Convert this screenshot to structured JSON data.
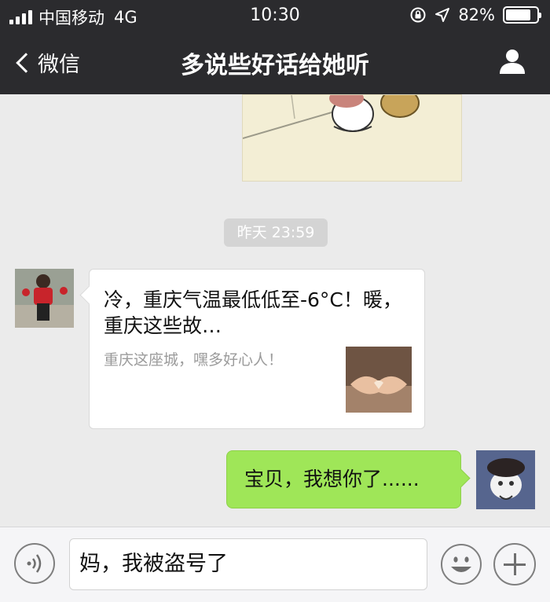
{
  "status_bar": {
    "carrier": "中国移动",
    "network": "4G",
    "time": "10:30",
    "battery_text": "82%",
    "battery_level": 0.82,
    "signal_bars": 4,
    "icons": [
      "signal-icon",
      "lock-rotation-icon",
      "location-icon",
      "battery-icon"
    ]
  },
  "nav": {
    "back_label": "微信",
    "title": "多说些好话给她听",
    "icons": [
      "chevron-left-icon",
      "profile-icon"
    ]
  },
  "chat": {
    "timestamp": "昨天 23:59",
    "article_card": {
      "title": "冷，重庆气温最低低至-6°C！暖，重庆这些故…",
      "description": "重庆这座城，嘿多好心人！"
    },
    "sent_message": "宝贝，我想你了......"
  },
  "input_bar": {
    "draft_text": "妈，我被盗号了",
    "icons": [
      "voice-icon",
      "emoji-icon",
      "plus-icon"
    ]
  },
  "colors": {
    "header_bg": "#2b2b2e",
    "chat_bg": "#ebebeb",
    "sent_bubble": "#9fe658",
    "input_bar_bg": "#f5f5f7"
  }
}
